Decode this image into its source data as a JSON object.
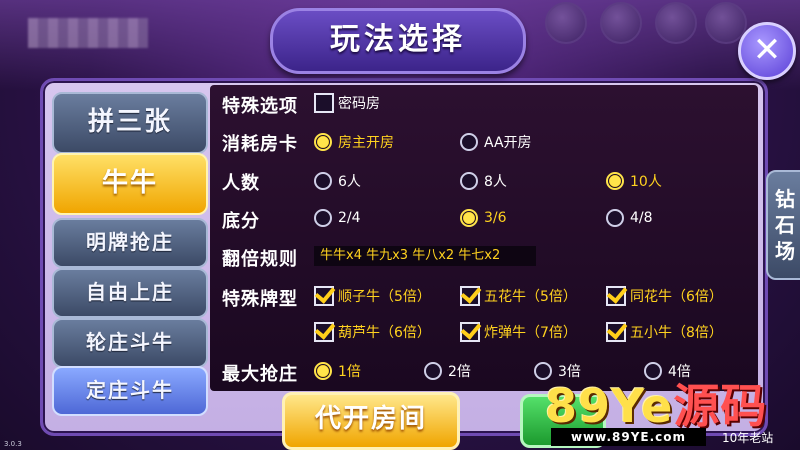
{
  "title": "玩法选择",
  "close_icon": "close-icon",
  "tabs": [
    {
      "label": "拼三张",
      "state": "normal"
    },
    {
      "label": "牛牛",
      "state": "active"
    },
    {
      "label": "明牌抢庄",
      "state": "normal"
    },
    {
      "label": "自由上庄",
      "state": "normal"
    },
    {
      "label": "轮庄斗牛",
      "state": "normal"
    },
    {
      "label": "定庄斗牛",
      "state": "blue"
    }
  ],
  "right_tab": {
    "label": [
      "钻",
      "石",
      "场"
    ]
  },
  "rows": {
    "special_options": {
      "label": "特殊选项",
      "options": [
        {
          "text": "密码房",
          "checked": false
        }
      ]
    },
    "room_cost": {
      "label": "消耗房卡",
      "options": [
        {
          "text": "房主开房",
          "selected": true
        },
        {
          "text": "AA开房",
          "selected": false
        }
      ]
    },
    "players": {
      "label": "人数",
      "options": [
        {
          "text": "6人",
          "selected": false
        },
        {
          "text": "8人",
          "selected": false
        },
        {
          "text": "10人",
          "selected": true
        }
      ]
    },
    "base_score": {
      "label": "底分",
      "options": [
        {
          "text": "2/4",
          "selected": false
        },
        {
          "text": "3/6",
          "selected": true
        },
        {
          "text": "4/8",
          "selected": false
        }
      ]
    },
    "double_rule": {
      "label": "翻倍规则",
      "value": "牛牛x4 牛九x3 牛八x2 牛七x2"
    },
    "special_hands": {
      "label": "特殊牌型",
      "options": [
        {
          "text": "顺子牛（5倍）",
          "checked": true
        },
        {
          "text": "五花牛（5倍）",
          "checked": true
        },
        {
          "text": "同花牛（6倍）",
          "checked": true
        },
        {
          "text": "葫芦牛（6倍）",
          "checked": true
        },
        {
          "text": "炸弹牛（7倍）",
          "checked": true
        },
        {
          "text": "五小牛（8倍）",
          "checked": true
        }
      ]
    },
    "max_bid": {
      "label": "最大抢庄",
      "options": [
        {
          "text": "1倍",
          "selected": true
        },
        {
          "text": "2倍",
          "selected": false
        },
        {
          "text": "3倍",
          "selected": false
        },
        {
          "text": "4倍",
          "selected": false
        }
      ]
    }
  },
  "create_button": "代开房间",
  "watermark": {
    "main": "89Ye",
    "cn": "源码",
    "url": "www.89YE.com",
    "tag": "10年老站"
  },
  "version": "3.0.3",
  "colors": {
    "accent_yellow": "#ffd21f",
    "panel_purple": "#6f4bb3"
  }
}
